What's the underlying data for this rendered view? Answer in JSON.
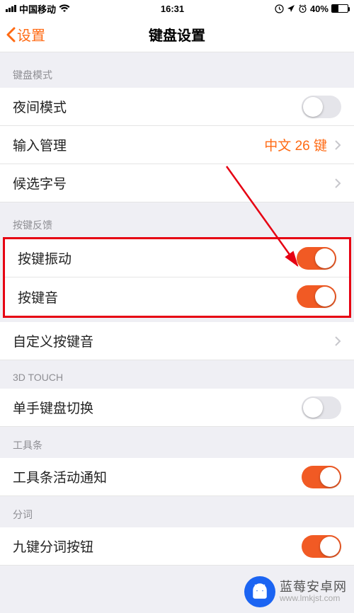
{
  "status": {
    "carrier": "中国移动",
    "time": "16:31",
    "battery_pct": "40%"
  },
  "nav": {
    "back_label": "设置",
    "title": "键盘设置"
  },
  "sections": {
    "keyboard_mode": {
      "header": "键盘模式",
      "night_mode": "夜间模式",
      "input_mgmt": "输入管理",
      "input_mgmt_value": "中文 26 键",
      "candidate_size": "候选字号"
    },
    "feedback": {
      "header": "按键反馈",
      "vibrate": "按键振动",
      "sound": "按键音",
      "custom_sound": "自定义按键音"
    },
    "three_d": {
      "header": "3D TOUCH",
      "onehand": "单手键盘切换"
    },
    "toolbar": {
      "header": "工具条",
      "activity_notice": "工具条活动通知"
    },
    "segmentation": {
      "header": "分词",
      "nine_key": "九键分词按钮"
    }
  },
  "toggles": {
    "night_mode": false,
    "vibrate": true,
    "sound": true,
    "onehand": false,
    "activity_notice": true,
    "nine_key": true
  },
  "watermark": {
    "cn": "蓝莓安卓网",
    "url": "www.lmkjst.com"
  }
}
